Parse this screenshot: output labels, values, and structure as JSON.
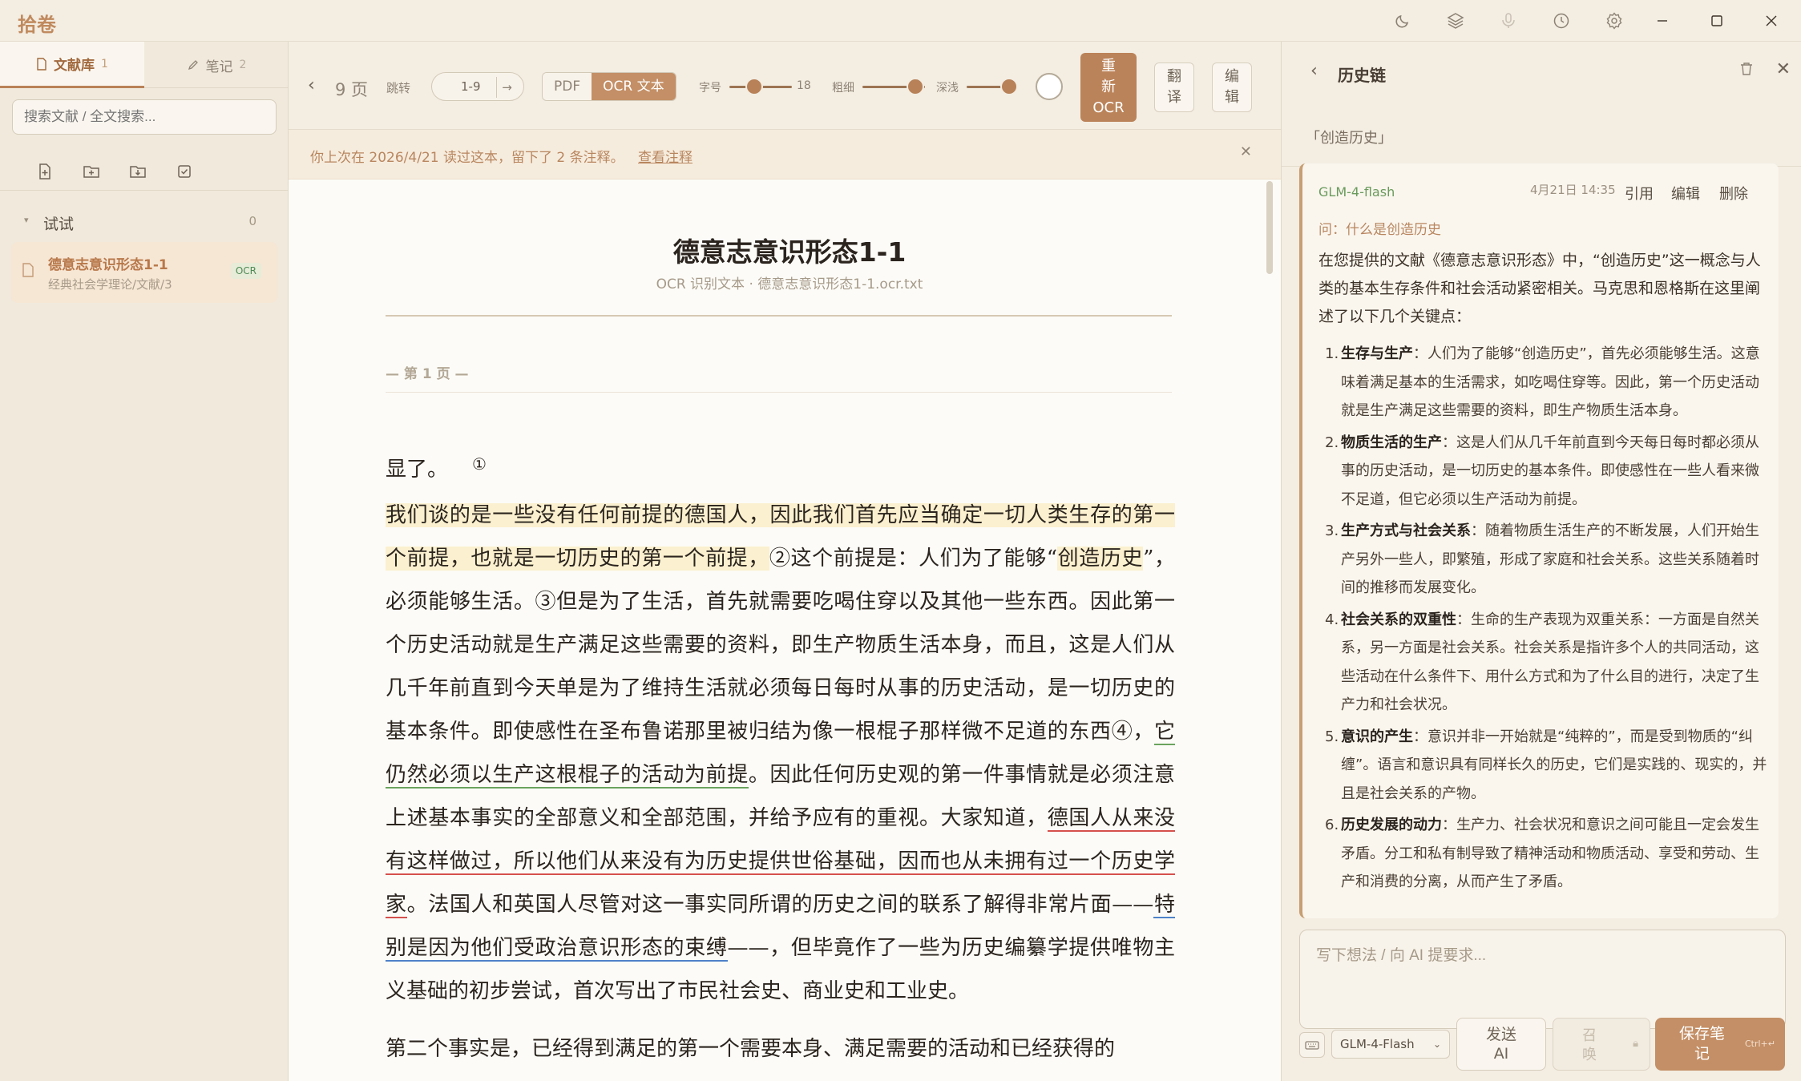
{
  "app": {
    "title": "拾卷"
  },
  "sidebar": {
    "tabs": [
      {
        "label": "文献库",
        "count": "1"
      },
      {
        "label": "笔记",
        "count": "2"
      }
    ],
    "search_placeholder": "搜索文献 / 全文搜索...",
    "folder": {
      "name": "试试",
      "count": "0"
    },
    "doc": {
      "title": "德意志意识形态1-1",
      "path": "经典社会学理论/文献/3",
      "badge": "OCR"
    }
  },
  "toolbar": {
    "pages": "9 页",
    "jump_label": "跳转",
    "page_range": "1-9",
    "view_pdf": "PDF",
    "view_ocr": "OCR 文本",
    "font_size_label": "字号",
    "font_size_value": "18",
    "font_size_level": 0.4,
    "weight_label": "粗细",
    "weight_level": 0.85,
    "shade_label": "深浅",
    "shade_level": 0.85,
    "reocr_label": [
      "重",
      "新",
      "OCR"
    ],
    "translate_label": [
      "翻",
      "译"
    ],
    "edit_label": [
      "编",
      "辑"
    ]
  },
  "notice": {
    "text": "你上次在 2026/4/21 读过这本，留下了 2 条注释。",
    "link": "查看注释"
  },
  "reader": {
    "title": "德意志意识形态1-1",
    "subtitle": "OCR 识别文本 · 德意志意识形态1-1.ocr.txt",
    "page_label": "— 第 1 页 —",
    "line0": "显了。",
    "line0_note": "①",
    "p1_hl1": "我们谈的是一些没有任何前提的德国人，因此我们首先应当确定一切人类生存的第一个前提，也就是一切历史的第一个前提，",
    "p1_a": "②这个前提是：人们为了能够“",
    "p1_hl2": "创造历史",
    "p1_b": "”，必须能够生活。③但是为了生活，首先就需要吃喝住穿以及其他一些东西。因此第一个历史活动就是生产满足这些需要的资料，即生产物质生活本身，而且，这是人们从几千年前直到今天单是为了维持生活就必须每日每时从事的历史活动，是一切历史的基本条件。即使感性在圣布鲁诺那里被归结为像一根棍子那样微不足道的东西④，",
    "p1_green": "它仍然必须以生产这根棍子的活动为前提",
    "p1_c": "。因此任何历史观的第一件事情就是必须注意上述基本事实的全部意义和全部范围，并给予应有的重视。大家知道，",
    "p1_red": "德国人从来没有这样做过，所以他们从来没有为历史提供世俗基础，因而也从未拥有过一个历史学家",
    "p1_d": "。法国人和英国人尽管对这一事实同所谓的历史之间的联系了解得非常片面——",
    "p1_blue": "特别是因为他们受政治意识形态的束缚",
    "p1_e": "——，但毕竟作了一些为历史编纂学提供唯物主义基础的初步尝试，首次写出了市民社会史、商业史和工业史。",
    "p2": "第二个事实是，已经得到满足的第一个需要本身、满足需要的活动和已经获得的"
  },
  "right_panel": {
    "title": "历史链",
    "context": "「创造历史」",
    "card": {
      "model": "GLM-4-flash",
      "time": "4月21日 14:35",
      "actions": [
        "引用",
        "编辑",
        "删除"
      ],
      "question": "问：什么是创造历史",
      "intro": "在您提供的文献《德意志意识形态》中，“创造历史”这一概念与人类的基本生存条件和社会活动紧密相关。马克思和恩格斯在这里阐述了以下几个关键点：",
      "items": [
        {
          "num": "1.",
          "head": "生存与生产",
          "text": "：人们为了能够“创造历史”，首先必须能够生活。这意味着满足基本的生活需求，如吃喝住穿等。因此，第一个历史活动就是生产满足这些需要的资料，即生产物质生活本身。"
        },
        {
          "num": "2.",
          "head": "物质生活的生产",
          "text": "：这是人们从几千年前直到今天每日每时都必须从事的历史活动，是一切历史的基本条件。即使感性在一些人看来微不足道，但它必须以生产活动为前提。"
        },
        {
          "num": "3.",
          "head": "生产方式与社会关系",
          "text": "：随着物质生活生产的不断发展，人们开始生产另外一些人，即繁殖，形成了家庭和社会关系。这些关系随着时间的推移而发展变化。"
        },
        {
          "num": "4.",
          "head": "社会关系的双重性",
          "text": "：生命的生产表现为双重关系：一方面是自然关系，另一方面是社会关系。社会关系是指许多个人的共同活动，这些活动在什么条件下、用什么方式和为了什么目的进行，决定了生产力和社会状况。"
        },
        {
          "num": "5.",
          "head": "意识的产生",
          "text": "：意识并非一开始就是“纯粹的”，而是受到物质的“纠缠”。语言和意识具有同样长久的历史，它们是实践的、现实的，并且是社会关系的产物。"
        },
        {
          "num": "6.",
          "head": "历史发展的动力",
          "text": "：生产力、社会状况和意识之间可能且一定会发生矛盾。分工和私有制导致了精神活动和物质活动、享受和劳动、生产和消费的分离，从而产生了矛盾。"
        }
      ]
    },
    "input_placeholder": "写下想法 / 向 AI 提要求...",
    "model_select": "GLM-4-Flash",
    "send_label": [
      "发送",
      "AI"
    ],
    "summon_label": [
      "召",
      "唤"
    ],
    "save_label": [
      "保存笔",
      "记"
    ],
    "save_shortcut": "Ctrl+↵"
  }
}
